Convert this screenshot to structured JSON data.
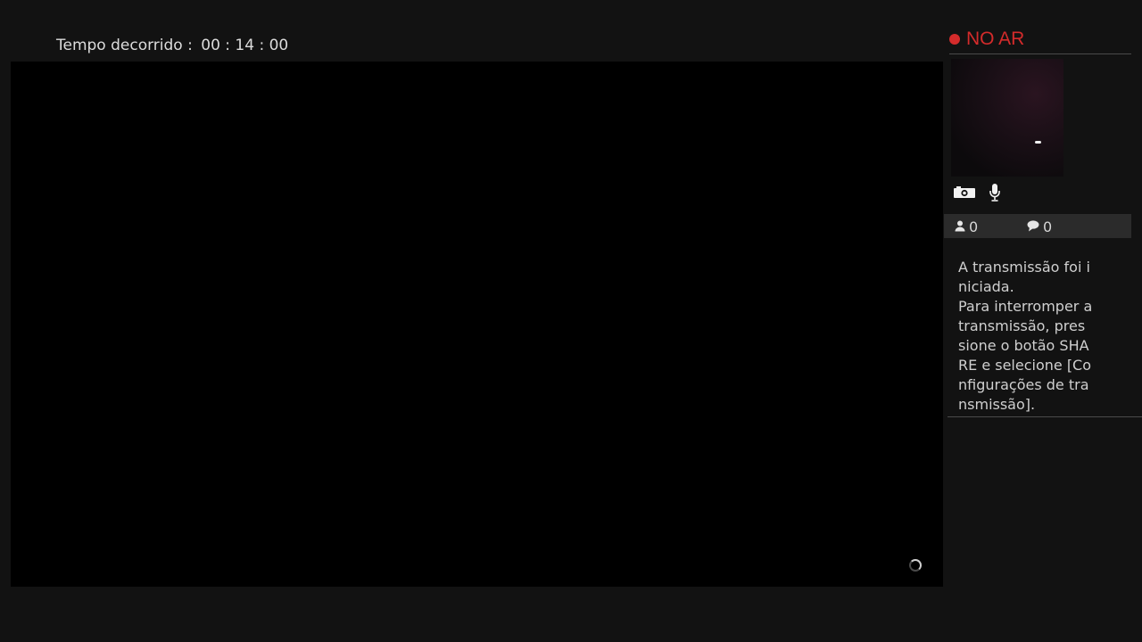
{
  "elapsed": {
    "label": "Tempo decorrido :",
    "time": "00 : 14 : 00"
  },
  "status": {
    "on_air_label": "NO AR",
    "on_air_color": "#d42b2b"
  },
  "icons": {
    "camera": "camera-icon",
    "microphone": "microphone-icon",
    "viewers": "viewers-icon",
    "comments": "comment-icon",
    "loading": "loading-spinner-icon"
  },
  "stats": {
    "viewers": "0",
    "comments": "0"
  },
  "message": {
    "text": "A transmissão foi i\nniciada.\nPara interromper a\ntransmissão, pres\nsione o botão SHA\nRE e selecione [Co\nnfigurações de tra\nnsmissão]."
  }
}
